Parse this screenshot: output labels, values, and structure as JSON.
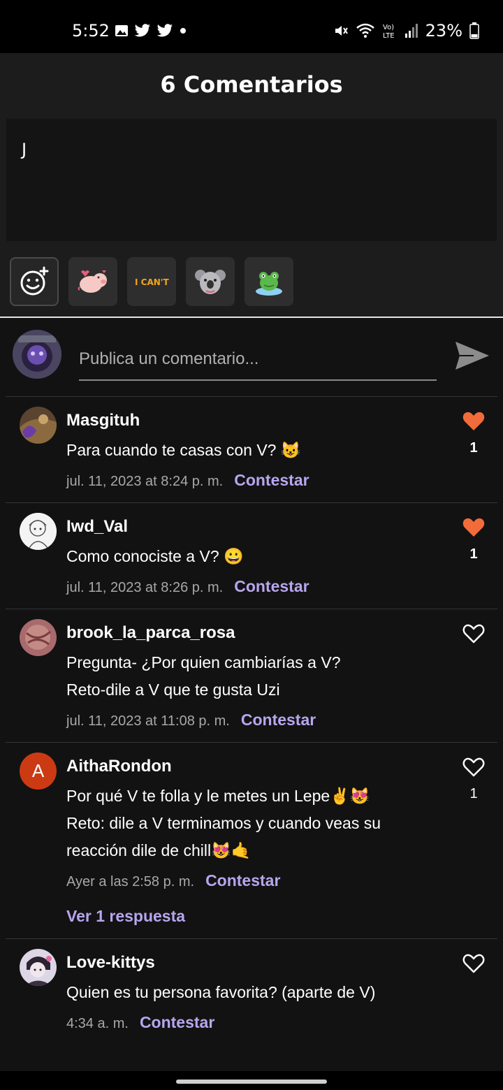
{
  "status_bar": {
    "time": "5:52",
    "battery": "23%",
    "left_icons": [
      "gallery-icon",
      "twitter-icon",
      "twitter-icon",
      "dot-icon"
    ],
    "right_icons": [
      "mute-icon",
      "wifi-icon",
      "volte-icon",
      "signal-icon",
      "battery-icon"
    ]
  },
  "header": {
    "title": "6 Comentarios"
  },
  "draft": {
    "text": "J"
  },
  "stickers": [
    {
      "icon": "emoji-picker-icon"
    },
    {
      "icon": "pig-sticker-icon"
    },
    {
      "icon": "i-cant-sticker-icon",
      "text": "I CAN'T"
    },
    {
      "icon": "koala-sticker-icon"
    },
    {
      "icon": "frog-sticker-icon"
    }
  ],
  "input": {
    "placeholder": "Publica un comentario..."
  },
  "colors": {
    "accent": "#b7a6ee",
    "heart": "#f26b3a",
    "background": "#121212"
  },
  "comments": [
    {
      "user": "Masgituh",
      "lines": [
        "Para cuando te casas con V? 😺"
      ],
      "date": "jul. 11, 2023 at 8:24 p. m.",
      "reply_label": "Contestar",
      "likes": "1",
      "liked": true
    },
    {
      "user": "Iwd_Val",
      "lines": [
        "Como conociste a V? 😀"
      ],
      "date": "jul. 11, 2023 at 8:26 p. m.",
      "reply_label": "Contestar",
      "likes": "1",
      "liked": true
    },
    {
      "user": "brook_la_parca_rosa",
      "lines": [
        "Pregunta- ¿Por quien cambiarías a V?",
        "Reto-dile a V que te gusta Uzi"
      ],
      "date": "jul. 11, 2023 at 11:08 p. m.",
      "reply_label": "Contestar",
      "likes": "",
      "liked": false
    },
    {
      "user": "AithaRondon",
      "avatar_letter": "A",
      "lines": [
        "Por qué V te folla y le metes un Lepe✌️😻",
        "Reto: dile a V terminamos y cuando veas su",
        "reacción dile de chill😻🤙"
      ],
      "date": "Ayer a las 2:58 p. m.",
      "reply_label": "Contestar",
      "likes": "1",
      "liked": false,
      "view_replies": "Ver 1 respuesta"
    },
    {
      "user": "Love-kittys",
      "lines": [
        "Quien es tu persona favorita? (aparte de V)"
      ],
      "date": "4:34 a. m.",
      "reply_label": "Contestar",
      "likes": "",
      "liked": false
    }
  ]
}
